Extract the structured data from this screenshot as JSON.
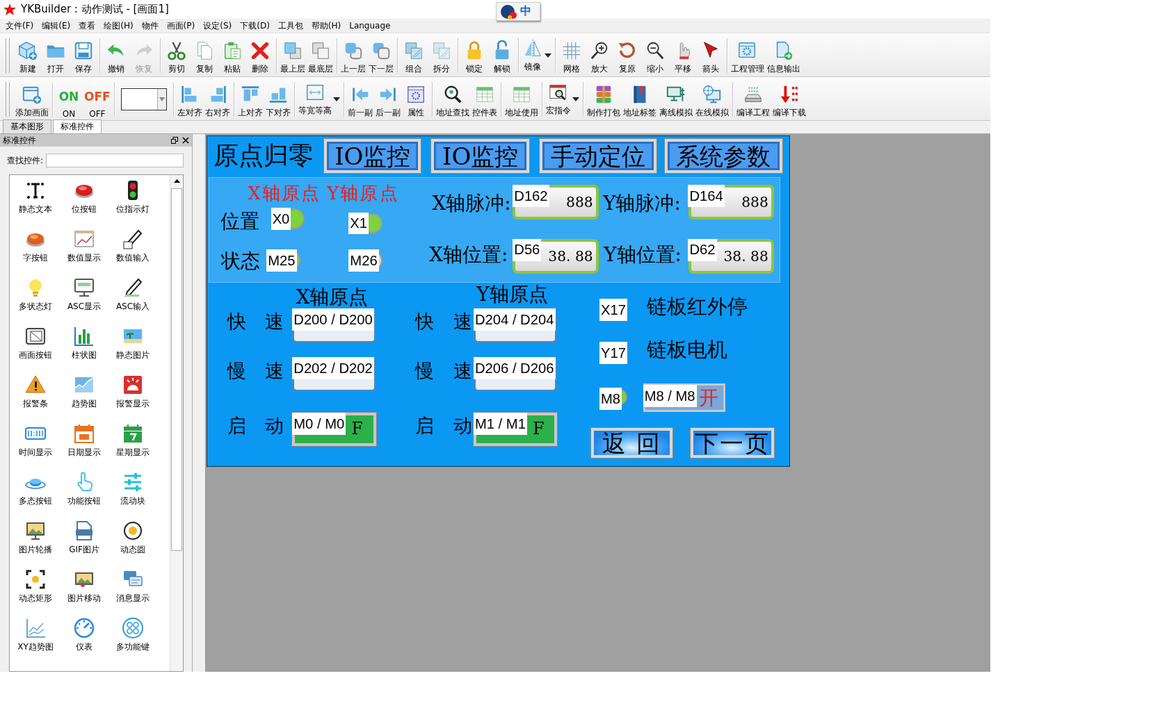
{
  "window": {
    "title": "YKBuilder : 动作测试 - [画面1]"
  },
  "ime": {
    "label": "中"
  },
  "menu": [
    "文件(F)",
    "编辑(E)",
    "查看",
    "绘图(H)",
    "物件",
    "画面(P)",
    "设定(S)",
    "下载(D)",
    "工具包",
    "帮助(H)",
    "Language"
  ],
  "toolbar_main": [
    [
      {
        "label": "新建",
        "kind": "button",
        "disabled": false
      },
      {
        "label": "打开",
        "kind": "button",
        "disabled": false
      },
      {
        "label": "保存",
        "kind": "button",
        "disabled": false
      }
    ],
    [
      {
        "label": "撤销",
        "kind": "button",
        "disabled": false
      },
      {
        "label": "恢复",
        "kind": "button",
        "disabled": true
      }
    ],
    [
      {
        "label": "剪切",
        "kind": "button",
        "disabled": false
      },
      {
        "label": "复制",
        "kind": "button",
        "disabled": false
      },
      {
        "label": "粘贴",
        "kind": "button",
        "disabled": false
      },
      {
        "label": "删除",
        "kind": "button",
        "disabled": false
      }
    ],
    [
      {
        "label": "最上层",
        "kind": "button",
        "disabled": false
      },
      {
        "label": "最底层",
        "kind": "button",
        "disabled": false
      }
    ],
    [
      {
        "label": "上一层",
        "kind": "button",
        "disabled": false
      },
      {
        "label": "下一层",
        "kind": "button",
        "disabled": false
      }
    ],
    [
      {
        "label": "组合",
        "kind": "button",
        "disabled": false
      },
      {
        "label": "拆分",
        "kind": "button",
        "disabled": false
      }
    ],
    [
      {
        "label": "锁定",
        "kind": "button",
        "disabled": false
      },
      {
        "label": "解锁",
        "kind": "button",
        "disabled": false
      }
    ],
    [
      {
        "label": "镜像",
        "kind": "split",
        "disabled": false
      }
    ],
    [
      {
        "label": "网格",
        "kind": "button",
        "disabled": false
      },
      {
        "label": "放大",
        "kind": "button",
        "disabled": false
      },
      {
        "label": "复原",
        "kind": "button",
        "disabled": false
      },
      {
        "label": "缩小",
        "kind": "button",
        "disabled": false
      },
      {
        "label": "平移",
        "kind": "button",
        "disabled": false
      },
      {
        "label": "箭头",
        "kind": "button",
        "disabled": false
      }
    ],
    [
      {
        "label": "工程管理",
        "kind": "button",
        "disabled": false
      },
      {
        "label": "信息输出",
        "kind": "button",
        "disabled": false
      }
    ]
  ],
  "toolbar_edit": [
    [
      {
        "label": "添加画面",
        "kind": "button",
        "disabled": false
      }
    ],
    [
      {
        "label": "ON",
        "kind": "glyph",
        "glyph": "ON",
        "color": "#22b33a",
        "disabled": false
      },
      {
        "label": "OFF",
        "kind": "glyph",
        "glyph": "OFF",
        "color": "#e8501e",
        "disabled": false
      }
    ],
    [
      {
        "kind": "combo",
        "disabled": false
      }
    ],
    [
      {
        "label": "左对齐",
        "kind": "button",
        "disabled": false
      },
      {
        "label": "右对齐",
        "kind": "button",
        "disabled": false
      }
    ],
    [
      {
        "label": "上对齐",
        "kind": "button",
        "disabled": false
      },
      {
        "label": "下对齐",
        "kind": "button",
        "disabled": false
      }
    ],
    [
      {
        "label": "等宽等高",
        "kind": "split",
        "disabled": false
      }
    ],
    [
      {
        "label": "前一副",
        "kind": "button",
        "disabled": false
      },
      {
        "label": "后一副",
        "kind": "button",
        "disabled": false
      },
      {
        "label": "属性",
        "kind": "button",
        "disabled": false
      }
    ],
    [
      {
        "label": "地址查找",
        "kind": "button",
        "disabled": false
      },
      {
        "label": "控件表",
        "kind": "button",
        "disabled": false
      }
    ],
    [
      {
        "label": "地址使用",
        "kind": "button",
        "disabled": false
      }
    ],
    [
      {
        "label": "宏指令",
        "kind": "split",
        "disabled": false
      }
    ],
    [
      {
        "label": "制作打包",
        "kind": "button",
        "disabled": false
      },
      {
        "label": "地址标签",
        "kind": "button",
        "disabled": false
      },
      {
        "label": "离线模拟",
        "kind": "button",
        "disabled": false
      },
      {
        "label": "在线模拟",
        "kind": "button",
        "disabled": false
      }
    ],
    [
      {
        "label": "编译工程",
        "kind": "button",
        "disabled": false
      },
      {
        "label": "编译下载",
        "kind": "button",
        "disabled": false
      }
    ]
  ],
  "panel": {
    "tabs": [
      {
        "label": "基本图形",
        "selected": false
      },
      {
        "label": "标准控件",
        "selected": true
      }
    ],
    "title": "标准控件",
    "search_label": "查找控件:",
    "controls": [
      "静态文本",
      "位按钮",
      "位指示灯",
      "字按钮",
      "数值显示",
      "数值输入",
      "多状态灯",
      "ASC显示",
      "ASC输入",
      "画面按钮",
      "柱状图",
      "静态图片",
      "报警条",
      "趋势图",
      "报警显示",
      "时间显示",
      "日期显示",
      "星期显示",
      "多态按钮",
      "功能按钮",
      "流动块",
      "图片轮播",
      "GIF图片",
      "动态圆",
      "动态矩形",
      "图片移动",
      "消息显示",
      "XY趋势图",
      "仪表",
      "多功能键"
    ]
  },
  "screen": {
    "title": "原点归零",
    "nav_buttons": [
      "IO监控",
      "IO监控",
      "手动定位",
      "系统参数"
    ],
    "status_panel": {
      "axis_headers": [
        "X轴原点",
        "Y轴原点"
      ],
      "row_labels": [
        "位置",
        "状态"
      ],
      "lamps": [
        {
          "address": "X0",
          "on": true
        },
        {
          "address": "X1",
          "on": true
        },
        {
          "address": "M25",
          "on": true
        },
        {
          "address": "M26",
          "on": false
        }
      ],
      "readouts": [
        {
          "label": "X轴脉冲:",
          "address": "D162",
          "value": "888"
        },
        {
          "label": "Y轴脉冲:",
          "address": "D164",
          "value": "888"
        },
        {
          "label": "X轴位置:",
          "address": "D56",
          "value": "38. 88"
        },
        {
          "label": "Y轴位置:",
          "address": "D62",
          "value": "38. 88"
        }
      ]
    },
    "axes": [
      {
        "header": "X轴原点",
        "rows": [
          {
            "label": "快 速",
            "kind": "input",
            "address": "D200 / D200"
          },
          {
            "label": "慢 速",
            "kind": "input",
            "address": "D202 / D202"
          },
          {
            "label": "启 动",
            "kind": "switch",
            "address": "M0 / M0",
            "value": "F"
          }
        ]
      },
      {
        "header": "Y轴原点",
        "rows": [
          {
            "label": "快 速",
            "kind": "input",
            "address": "D204 / D204"
          },
          {
            "label": "慢 速",
            "kind": "input",
            "address": "D206 / D206"
          },
          {
            "label": "启 动",
            "kind": "switch",
            "address": "M1 / M1",
            "value": "F"
          }
        ]
      }
    ],
    "chain": [
      {
        "address": "X17",
        "label": "链板红外停"
      },
      {
        "address": "Y17",
        "label": "链板电机"
      }
    ],
    "m8": {
      "lamp": "M8",
      "lamp_on": true,
      "address": "M8 / M8",
      "value": "开"
    },
    "footer_buttons": [
      "返 回",
      "下一页"
    ]
  }
}
